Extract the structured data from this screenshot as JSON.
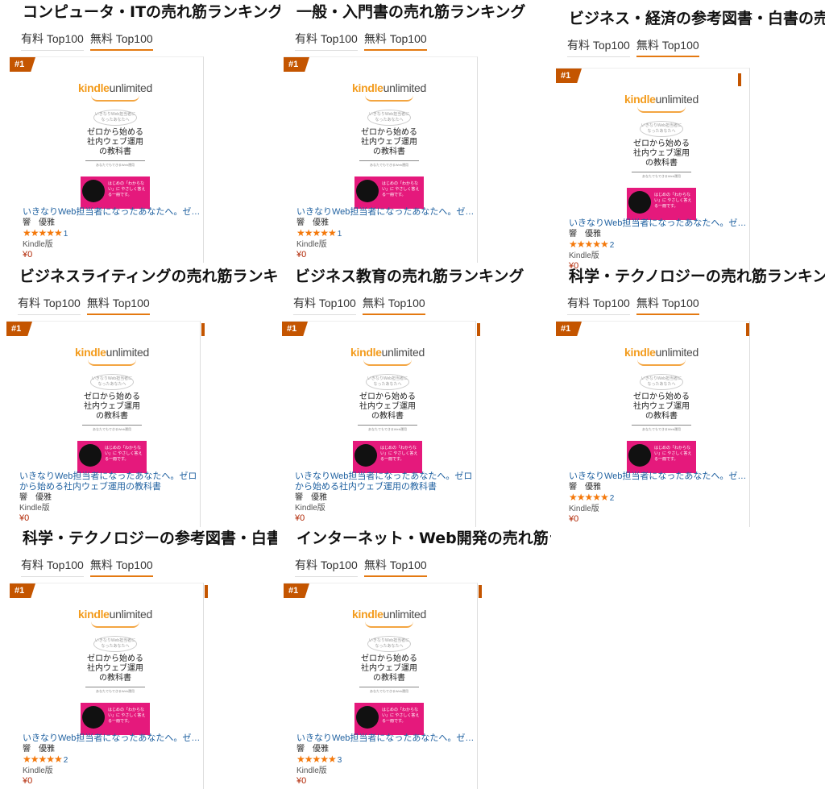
{
  "cover": {
    "brand_kindle": "kindle",
    "brand_unlimited": "unlimited",
    "bubble_text": "いきなりWeb担当者になったあなたへ",
    "book_title": "ゼロから始める\n社内ウェブ運用\nの教科書",
    "subtitle": "あなたでもできるWeb運用",
    "band_text": "はじめの「わからない」に やさしく答える一冊です。"
  },
  "sections": [
    {
      "title": "コンピュータ・ITの売れ筋ランキング",
      "tab_paid": "有料 Top100",
      "tab_free": "無料 Top100",
      "card": {
        "rank": "#1",
        "title": "いきなりWeb担当者になったあなたへ。ゼロ…",
        "author": "響　優雅",
        "stars": "★★★★★",
        "review_count": "1",
        "format": "Kindle版",
        "price": "¥0"
      }
    },
    {
      "title": "一般・入門書の売れ筋ランキング",
      "tab_paid": "有料 Top100",
      "tab_free": "無料 Top100",
      "card": {
        "rank": "#1",
        "title": "いきなりWeb担当者になったあなたへ。ゼロ…",
        "author": "響　優雅",
        "stars": "★★★★★",
        "review_count": "1",
        "format": "Kindle版",
        "price": "¥0"
      }
    },
    {
      "title": "ビジネス・経済の参考図書・白書の売れ筋",
      "tab_paid": "有料 Top100",
      "tab_free": "無料 Top100",
      "card": {
        "rank": "#1",
        "title": "いきなりWeb担当者になったあなたへ。ゼロ…",
        "author": "響　優雅",
        "stars": "★★★★★",
        "review_count": "2",
        "format": "Kindle版",
        "price": "¥0"
      }
    },
    {
      "title": "ビジネスライティングの売れ筋ランキン",
      "tab_paid": "有料 Top100",
      "tab_free": "無料 Top100",
      "card": {
        "rank": "#1",
        "title": "いきなりWeb担当者になったあなたへ。ゼロから始める社内ウェブ運用の教科書",
        "author": "響　優雅",
        "stars": "",
        "review_count": "",
        "format": "Kindle版",
        "price": "¥0"
      }
    },
    {
      "title": "ビジネス教育の売れ筋ランキング",
      "tab_paid": "有料 Top100",
      "tab_free": "無料 Top100",
      "card": {
        "rank": "#1",
        "title": "いきなりWeb担当者になったあなたへ。ゼロから始める社内ウェブ運用の教科書",
        "author": "響　優雅",
        "stars": "",
        "review_count": "",
        "format": "Kindle版",
        "price": "¥0"
      }
    },
    {
      "title": "科学・テクノロジーの売れ筋ランキング",
      "tab_paid": "有料 Top100",
      "tab_free": "無料 Top100",
      "card": {
        "rank": "#1",
        "title": "いきなりWeb担当者になったあなたへ。ゼロ…",
        "author": "響　優雅",
        "stars": "★★★★★",
        "review_count": "2",
        "format": "Kindle版",
        "price": "¥0"
      }
    },
    {
      "title": "科学・テクノロジーの参考図書・白書の",
      "tab_paid": "有料 Top100",
      "tab_free": "無料 Top100",
      "card": {
        "rank": "#1",
        "title": "いきなりWeb担当者になったあなたへ。ゼロ…",
        "author": "響　優雅",
        "stars": "★★★★★",
        "review_count": "2",
        "format": "Kindle版",
        "price": "¥0"
      }
    },
    {
      "title": "インターネット・Web開発の売れ筋ラン",
      "tab_paid": "有料 Top100",
      "tab_free": "無料 Top100",
      "card": {
        "rank": "#1",
        "title": "いきなりWeb担当者になったあなたへ。ゼロ…",
        "author": "響　優雅",
        "stars": "★★★★★",
        "review_count": "3",
        "format": "Kindle版",
        "price": "¥0"
      }
    }
  ]
}
